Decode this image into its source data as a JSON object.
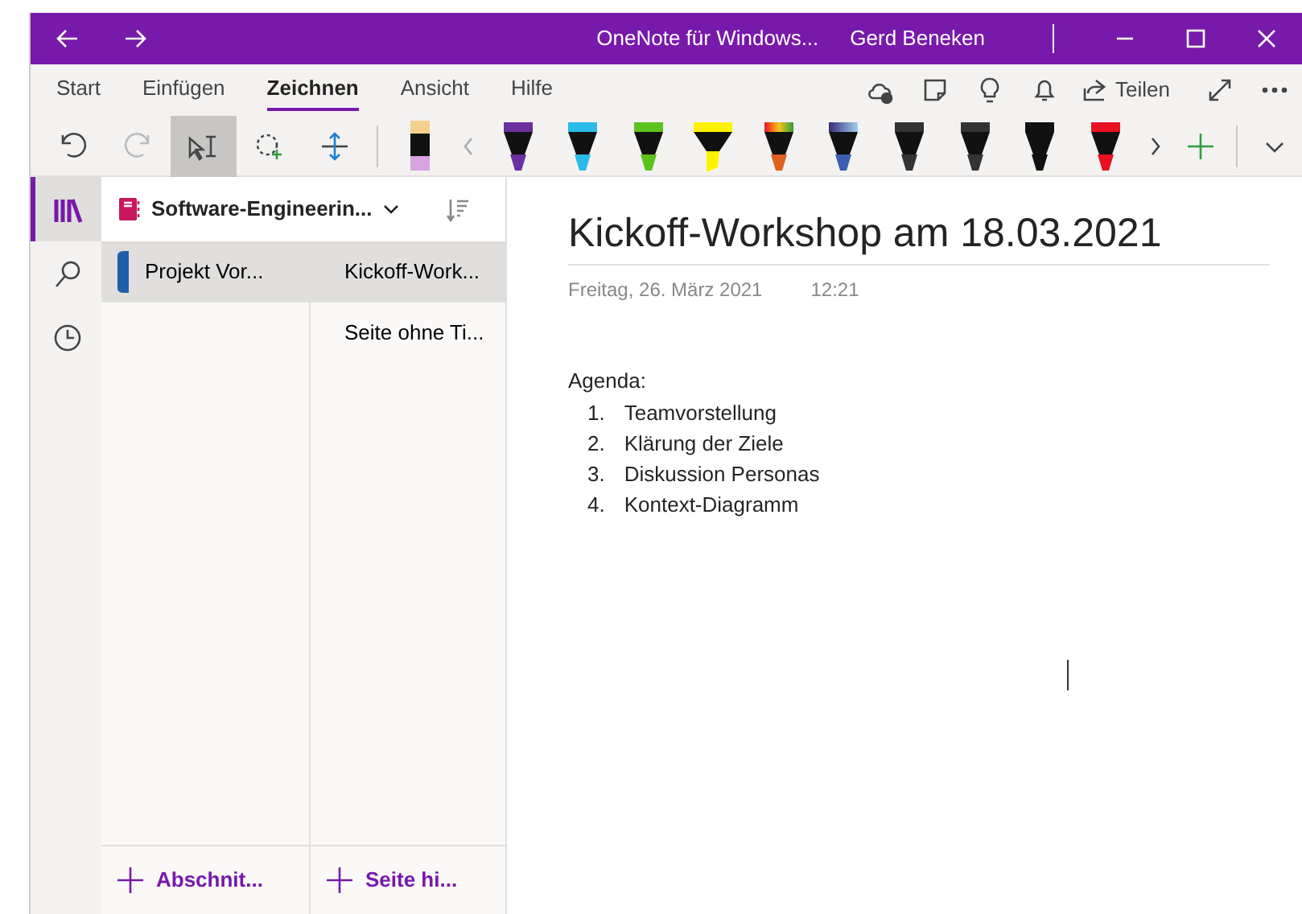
{
  "window": {
    "title": "OneNote für Windows...",
    "user": "Gerd Beneken"
  },
  "ribbon_tabs": [
    {
      "label": "Start",
      "selected": false
    },
    {
      "label": "Einfügen",
      "selected": false
    },
    {
      "label": "Zeichnen",
      "selected": true
    },
    {
      "label": "Ansicht",
      "selected": false
    },
    {
      "label": "Hilfe",
      "selected": false
    }
  ],
  "share_button": {
    "label": "Teilen"
  },
  "tools": [
    {
      "kind": "undo",
      "selected": false,
      "disabled": false
    },
    {
      "kind": "redo",
      "selected": false,
      "disabled": true
    },
    {
      "kind": "ink-to-text",
      "selected": true,
      "disabled": false
    },
    {
      "kind": "lasso",
      "selected": false,
      "disabled": false
    },
    {
      "kind": "space",
      "selected": false,
      "disabled": false
    }
  ],
  "pens": [
    {
      "kind": "eraser",
      "color": "#d9a3e0"
    },
    {
      "kind": "pen",
      "color": "#6b2fa0"
    },
    {
      "kind": "pen",
      "color": "#2bbbe8"
    },
    {
      "kind": "pen",
      "color": "#5cc21d"
    },
    {
      "kind": "highlighter",
      "color": "#fff200"
    },
    {
      "kind": "rainbow",
      "color": "#e06020"
    },
    {
      "kind": "galaxy",
      "color": "#3a5fb0"
    },
    {
      "kind": "pen",
      "color": "#333333"
    },
    {
      "kind": "pen",
      "color": "#333333"
    },
    {
      "kind": "pen",
      "color": "#111111"
    },
    {
      "kind": "pen",
      "color": "#e81123"
    }
  ],
  "nav_rail": [
    {
      "kind": "notebooks",
      "selected": true
    },
    {
      "kind": "search",
      "selected": false
    },
    {
      "kind": "recent",
      "selected": false
    }
  ],
  "notebook": {
    "name": "Software-Engineerin..."
  },
  "sections": [
    {
      "name": "Projekt Vor...",
      "color": "#1f5ea8",
      "selected": true
    }
  ],
  "pages": [
    {
      "title": "Kickoff-Work...",
      "selected": true
    },
    {
      "title": "Seite ohne Ti...",
      "selected": false
    }
  ],
  "add_section": {
    "label": "Abschnit..."
  },
  "add_page": {
    "label": "Seite hi..."
  },
  "page": {
    "title": "Kickoff-Workshop am 18.03.2021",
    "date": "Freitag, 26. März 2021",
    "time": "12:21",
    "heading": "Agenda:",
    "items": [
      {
        "number": "1.",
        "text": "Teamvorstellung"
      },
      {
        "number": "2.",
        "text": "Klärung der Ziele"
      },
      {
        "number": "3.",
        "text": "Diskussion Personas"
      },
      {
        "number": "4.",
        "text": "Kontext-Diagramm"
      }
    ]
  }
}
